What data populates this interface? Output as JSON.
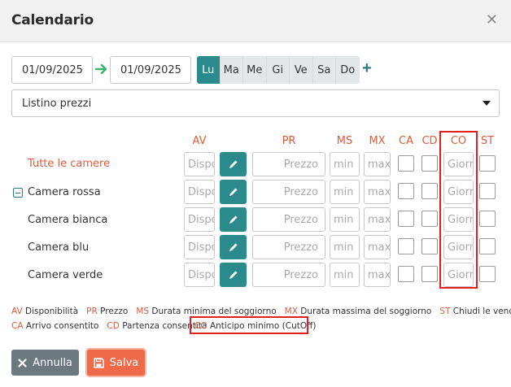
{
  "dialog": {
    "title": "Calendario",
    "close_icon": "close-icon"
  },
  "dates": {
    "from": "01/09/2025",
    "to": "01/09/2025"
  },
  "weekdays": [
    "Lu",
    "Ma",
    "Me",
    "Gi",
    "Ve",
    "Sa",
    "Do"
  ],
  "active_weekday": "Lu",
  "listino": {
    "selected": "Listino prezzi"
  },
  "columns": {
    "av": "AV",
    "pr": "PR",
    "ms": "MS",
    "mx": "MX",
    "ca": "CA",
    "cd": "CD",
    "co": "CO",
    "st": "ST"
  },
  "placeholders": {
    "av": "Dispo",
    "pr": "Prezzo",
    "ms": "min",
    "mx": "max",
    "co": "Giorni"
  },
  "rows": [
    {
      "label": "Tutte le camere"
    },
    {
      "label": "Camera rossa"
    },
    {
      "label": "Camera bianca"
    },
    {
      "label": "Camera blu"
    },
    {
      "label": "Camera verde"
    }
  ],
  "legend": {
    "av": {
      "abbr": "AV",
      "text": "Disponibilità"
    },
    "pr": {
      "abbr": "PR",
      "text": "Prezzo"
    },
    "ms": {
      "abbr": "MS",
      "text": "Durata minima del soggiorno"
    },
    "mx": {
      "abbr": "MX",
      "text": "Durata massima del soggiorno"
    },
    "st": {
      "abbr": "ST",
      "text": "Chiudi le vendite"
    },
    "ca": {
      "abbr": "CA",
      "text": "Arrivo consentito"
    },
    "cd": {
      "abbr": "CD",
      "text": "Partenza consentita"
    },
    "co": {
      "abbr": "CO",
      "text": "Anticipo minimo (CutOff)"
    }
  },
  "buttons": {
    "cancel": "Annulla",
    "save": "Salva"
  },
  "colors": {
    "accent": "#2b8a8c",
    "label": "#e05a3a",
    "save": "#f06a4a",
    "cancel": "#6c7a80",
    "highlight": "#e01f1f"
  }
}
